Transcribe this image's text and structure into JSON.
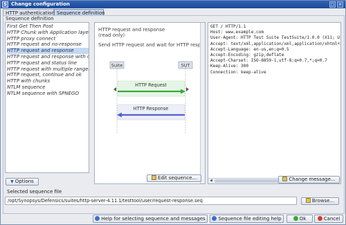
{
  "window": {
    "title": "Change configuration",
    "app_icon": "S"
  },
  "tabs": [
    {
      "label": "HTTP authentication"
    },
    {
      "label": "Sequence definition"
    }
  ],
  "sequence_group_label": "Sequence definition",
  "sequences": [
    {
      "label": "First Get Then Post"
    },
    {
      "label": "HTTP Chunk with Application layer"
    },
    {
      "label": "HTTP proxy connect"
    },
    {
      "label": "HTTP request and no-response"
    },
    {
      "label": "HTTP request and response"
    },
    {
      "label": "HTTP request and response with cookie"
    },
    {
      "label": "HTTP request and status line"
    },
    {
      "label": "HTTP request with multiple ranges"
    },
    {
      "label": "HTTP request, continue and ok"
    },
    {
      "label": "HTTP with chunks"
    },
    {
      "label": "NTLM sequence"
    },
    {
      "label": "NTLM sequence with SPNEGO"
    }
  ],
  "options_button": "Options",
  "description": {
    "title": "HTTP request and response",
    "subtitle": "(read only)",
    "body": "Send HTTP request and wait for HTTP response."
  },
  "diagram": {
    "left_actor": "Suite",
    "right_actor": "SUT",
    "request_label": "HTTP Request",
    "response_label": "HTTP Response",
    "request_color": "#3aa83a",
    "response_color": "#5560c8"
  },
  "edit_sequence_button": "Edit sequence...",
  "message_lines": [
    "GET / HTTP/1.1",
    "Host: www.example.com",
    "User-Agent: HTTP Test Suite TestSuite/1.0.0 (X11; U;",
    "Accept: text/xml,application/xml,application/xhtml+xm",
    "Accept-Language: en-us,en;q=0.5",
    "Accept-Encoding: gzip,deflate",
    "Accept-Charset: ISO-8859-1,utf-8;q=0.7,*;q=0.7",
    "Keep-Alive: 300",
    "Connection: keep-alive"
  ],
  "change_message_button": "Change message...",
  "selected_file_label": "Selected sequence file",
  "selected_file_path": "/opt/Synopsys/Defensics/suites/http-server-4.11.1/testtool/user/request-response.seq",
  "browse_button": "Browse...",
  "help_sequence_button": "Help for selecting sequence and messages",
  "help_file_button": "Sequence file editing help",
  "ok_button": "Ok",
  "cancel_button": "Cancel"
}
